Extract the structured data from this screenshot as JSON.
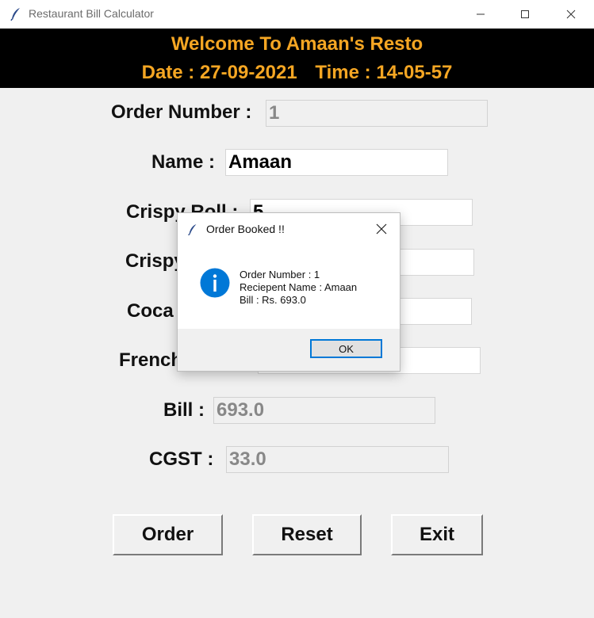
{
  "window": {
    "title": "Restaurant Bill Calculator",
    "buttons": [
      "minimize",
      "maximize",
      "close"
    ]
  },
  "banner": {
    "welcome": "Welcome To Amaan's Resto",
    "date": "Date : 27-09-2021",
    "time": "Time : 14-05-57",
    "color": "#f5a623",
    "background": "#000000"
  },
  "form": {
    "order_number_label": "Order Number :",
    "order_number_value": "1",
    "name_label": "Name :",
    "name_value": "Amaan",
    "crispy_roll_label_visible": "Crispy Roll :",
    "crispy_roll_value": "5",
    "crispy2_label_visible": "Crispy",
    "coca_label_visible": "Coca",
    "french_label_visible": "French",
    "bill_label": "Bill :",
    "bill_value": "693.0",
    "cgst_label": "CGST :",
    "cgst_value": "33.0"
  },
  "buttons": {
    "order": "Order",
    "reset": "Reset",
    "exit": "Exit"
  },
  "dialog": {
    "title": "Order Booked !!",
    "lines": [
      "Order Number : 1",
      "Reciepent Name : Amaan",
      "Bill : Rs. 693.0"
    ],
    "ok_label": "OK",
    "icon": "info-icon",
    "accent": "#0078d7"
  }
}
